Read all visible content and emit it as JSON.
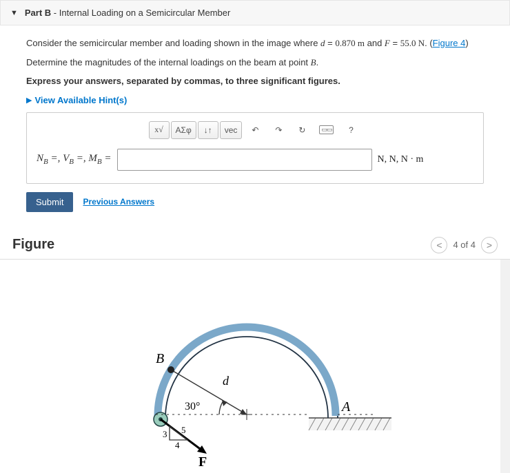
{
  "part": {
    "label": "Part B",
    "title": "Internal Loading on a Semicircular Member"
  },
  "prompt": {
    "line1a": "Consider the semicircular member and loading shown in the image where ",
    "var_d": "d",
    "eq1": " = ",
    "val_d": "0.870 m",
    "and": " and ",
    "var_F": "F",
    "val_F": "55.0 N",
    "figref_open": ". (",
    "figref": "Figure 4",
    "figref_close": ")",
    "line2a": "Determine the magnitudes of the internal loadings on the beam at point ",
    "ptB": "B",
    "line2b": ".",
    "instruction": "Express your answers, separated by commas, to three significant figures."
  },
  "hints": {
    "label": "View Available Hint(s)"
  },
  "toolbar": {
    "template": "x√",
    "greek": "ΑΣφ",
    "subscript": "↓↑",
    "vec": "vec",
    "undo": "↶",
    "redo": "↷",
    "reset": "↻",
    "keyboard": "⌨",
    "help": "?"
  },
  "answer": {
    "lhs_N": "N",
    "lhs_V": "V",
    "lhs_M": "M",
    "lhs_sub": "B",
    "eq": " =",
    "units": "N, N, N · m",
    "value": ""
  },
  "actions": {
    "submit": "Submit",
    "previous": "Previous Answers"
  },
  "figure": {
    "heading": "Figure",
    "pager_text": "4 of 4",
    "labels": {
      "B": "B",
      "A": "A",
      "d": "d",
      "angle": "30°",
      "F": "F",
      "t3": "3",
      "t4": "4",
      "t5": "5"
    }
  }
}
